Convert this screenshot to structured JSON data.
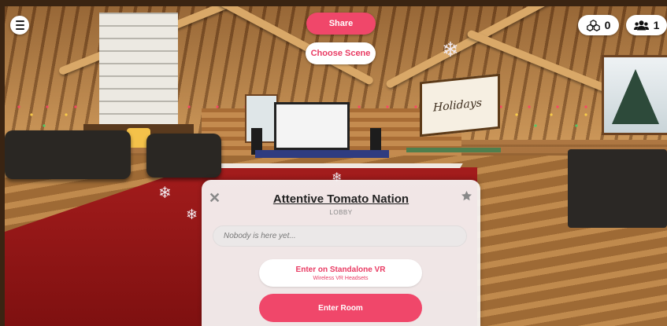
{
  "colors": {
    "accent": "#f0476a",
    "accent_text": "#e93b63",
    "panel_bg": "#f8f6f6",
    "rug": "#a31c1c"
  },
  "scene": {
    "poster_text": "Holidays"
  },
  "header": {
    "menu_icon": "hamburger-menu-icon",
    "share_label": "Share",
    "choose_scene_label": "Choose Scene",
    "objects_icon": "objects-icon",
    "objects_count": "0",
    "people_icon": "people-icon",
    "people_count": "1"
  },
  "lobby": {
    "close_icon": "close-icon",
    "favorite_icon": "star-icon",
    "room_name": "Attentive Tomato Nation",
    "subtitle": "LOBBY",
    "presence_text": "Nobody is here yet...",
    "vr_button_label": "Enter on Standalone VR",
    "vr_button_sublabel": "Wireless VR Headsets",
    "enter_button_label": "Enter Room"
  }
}
